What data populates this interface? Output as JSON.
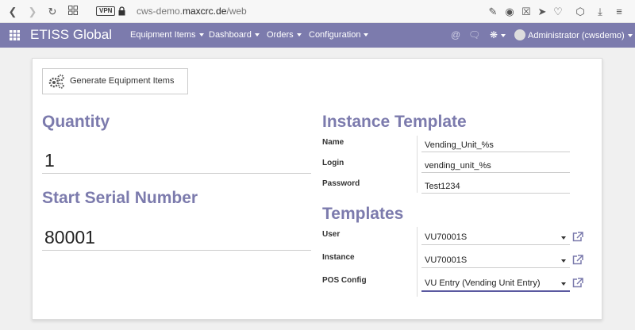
{
  "browser": {
    "vpn_label": "VPN",
    "url_prefix": "cws-demo.",
    "url_domain": "maxcrc.de",
    "url_path": "/web"
  },
  "navbar": {
    "brand": "ETISS Global",
    "menu": [
      {
        "label": "Equipment Items"
      },
      {
        "label": "Dashboard"
      },
      {
        "label": "Orders"
      },
      {
        "label": "Configuration"
      }
    ],
    "user": "Administrator (cwsdemo)"
  },
  "form": {
    "generate_button": "Generate Equipment Items",
    "quantity_heading": "Quantity",
    "quantity_value": "1",
    "serial_heading": "Start Serial Number",
    "serial_value": "80001",
    "instance_heading": "Instance Template",
    "name_label": "Name",
    "name_value": "Vending_Unit_%s",
    "login_label": "Login",
    "login_value": "vending_unit_%s",
    "password_label": "Password",
    "password_value": "Test1234",
    "templates_heading": "Templates",
    "user_label": "User",
    "user_value": "VU70001S",
    "instance_label": "Instance",
    "instance_value": "VU70001S",
    "pos_label": "POS Config",
    "pos_value": "VU Entry (Vending Unit Entry)"
  },
  "colors": {
    "brand": "#7c7bad",
    "active_underline": "#5a59a0"
  }
}
